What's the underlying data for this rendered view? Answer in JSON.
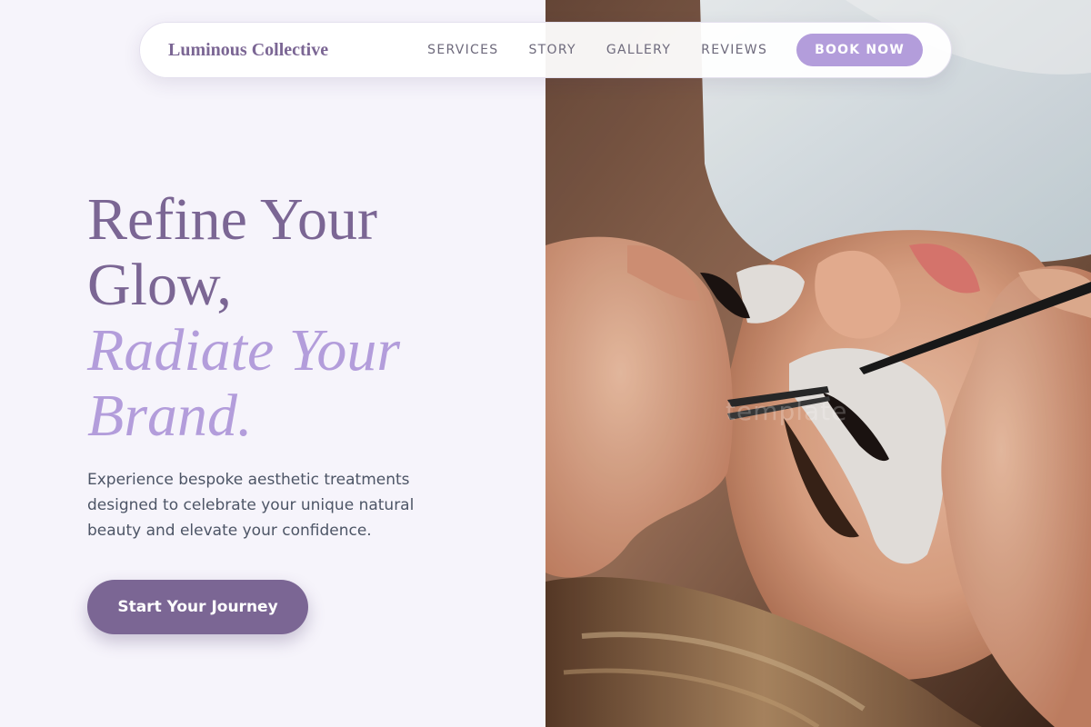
{
  "brand": {
    "name": "Luminous Collective"
  },
  "nav": {
    "items": [
      {
        "label": "SERVICES"
      },
      {
        "label": "STORY"
      },
      {
        "label": "GALLERY"
      },
      {
        "label": "REVIEWS"
      }
    ],
    "cta_label": "BOOK NOW"
  },
  "hero": {
    "title_line1": "Refine Your",
    "title_line2": "Glow,",
    "title_accent1": "Radiate Your",
    "title_accent2": "Brand.",
    "subtitle": "Experience bespoke aesthetic treatments designed to celebrate your unique natural beauty and elevate your confidence.",
    "cta_label": "Start Your Journey"
  },
  "photo": {
    "watermark": "template"
  },
  "colors": {
    "primary": "#7b6694",
    "accent": "#b39ddb",
    "background": "#f6f4fb",
    "body_text": "#4d5566"
  }
}
